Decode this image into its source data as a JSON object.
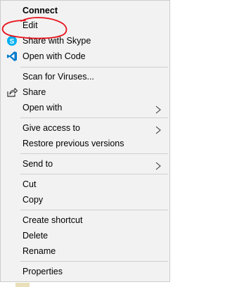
{
  "menu": {
    "connect": "Connect",
    "edit": "Edit",
    "share_skype": "Share with Skype",
    "open_code": "Open with Code",
    "scan": "Scan for Viruses...",
    "share": "Share",
    "open_with": "Open with",
    "give_access": "Give access to",
    "restore": "Restore previous versions",
    "send_to": "Send to",
    "cut": "Cut",
    "copy": "Copy",
    "create_shortcut": "Create shortcut",
    "delete": "Delete",
    "rename": "Rename",
    "properties": "Properties"
  },
  "icons": {
    "skype": "skype-icon",
    "vscode": "vscode-icon",
    "share": "share-icon",
    "submenu": "chevron-right-icon"
  },
  "colors": {
    "menu_bg": "#f2f2f2",
    "separator": "#cfcfcf",
    "skype_blue": "#00aff0",
    "vscode_blue": "#007acc",
    "annotation_red": "#e8101a"
  }
}
